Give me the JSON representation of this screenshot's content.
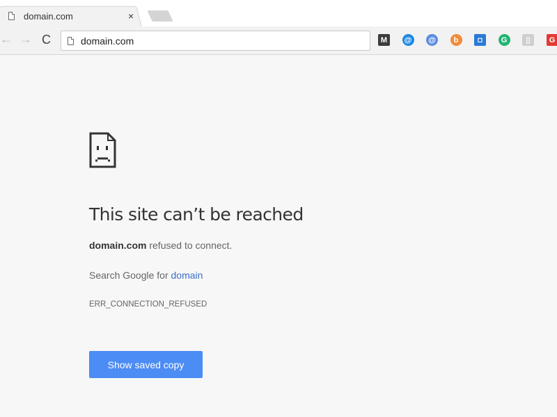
{
  "tab": {
    "title": "domain.com",
    "close": "×"
  },
  "toolbar": {
    "back": "←",
    "forward": "→",
    "reload": "C",
    "url": "domain.com"
  },
  "extensions": [
    {
      "name": "m-extension-icon",
      "glyph": "M",
      "color": "#3c3c3c"
    },
    {
      "name": "at-circle-icon",
      "glyph": "@",
      "color": "#1e88e5"
    },
    {
      "name": "at-badge-icon",
      "glyph": "@",
      "color": "#5b8de0"
    },
    {
      "name": "b-circle-icon",
      "glyph": "b",
      "color": "#f08c3c"
    },
    {
      "name": "window-camera-icon",
      "glyph": "◘",
      "color": "#2b7ad6"
    },
    {
      "name": "grammarly-icon",
      "glyph": "G",
      "color": "#22b573"
    },
    {
      "name": "clipboard-icon",
      "glyph": "▯",
      "color": "#cfcfcf"
    },
    {
      "name": "red-g-icon",
      "glyph": "G",
      "color": "#e53935"
    }
  ],
  "error": {
    "title": "This site can’t be reached",
    "domain": "domain.com",
    "refused": " refused to connect.",
    "search_prefix": "Search Google for ",
    "search_link": "domain",
    "code": "ERR_CONNECTION_REFUSED",
    "button": "Show saved copy"
  }
}
